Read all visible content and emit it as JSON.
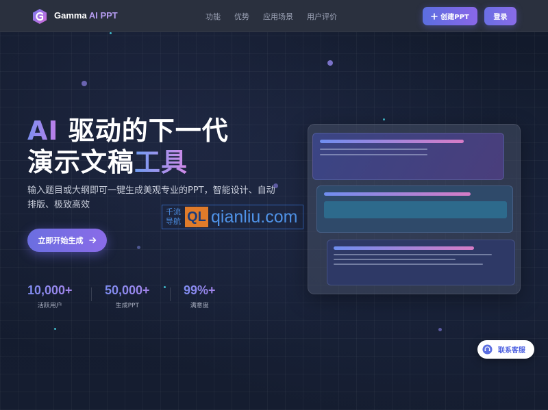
{
  "header": {
    "brand_name": "Gamma",
    "brand_suffix": "AI PPT",
    "nav": [
      "功能",
      "优势",
      "应用场景",
      "用户评价"
    ],
    "create_label": "创建PPT",
    "login_label": "登录"
  },
  "hero": {
    "line1_accent": "AI",
    "line1_rest": "驱动的下一代",
    "line2_main": "演示文稿",
    "line2_accent": "工具",
    "subtitle": "输入题目或大纲即可一键生成美观专业的PPT，智能设计、自动排版、极致高效",
    "start_label": "立即开始生成",
    "stats": [
      {
        "value": "10,000+",
        "label": "活跃用户"
      },
      {
        "value": "50,000+",
        "label": "生成PPT"
      },
      {
        "value": "99%+",
        "label": "满意度"
      }
    ]
  },
  "watermark": {
    "small_top": "千流",
    "small_bottom": "导航",
    "logo": "QL",
    "text": "qianliu.com"
  },
  "support": {
    "label": "联系客服"
  },
  "colors": {
    "accent": "#6b6ee0",
    "accent_purple": "#8a6ce8",
    "background": "#131a2c",
    "header_bg": "#2a303e"
  }
}
